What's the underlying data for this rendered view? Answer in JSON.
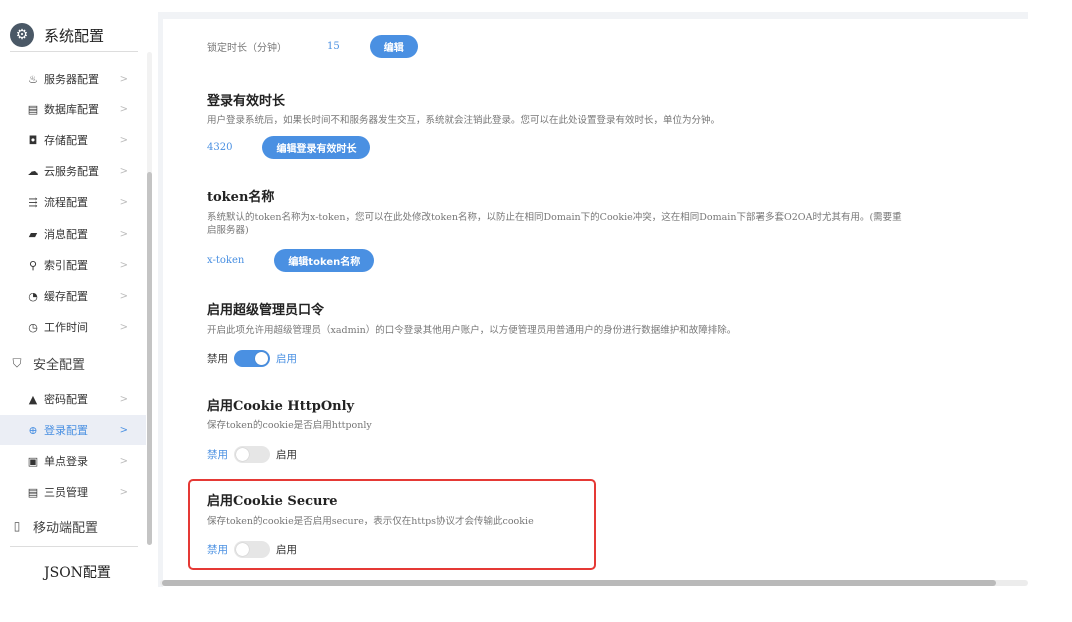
{
  "sidebar": {
    "title": "系统配置",
    "items": [
      {
        "icon": "server-icon",
        "glyph": "♨",
        "label": "服务器配置"
      },
      {
        "icon": "database-icon",
        "glyph": "▤",
        "label": "数据库配置"
      },
      {
        "icon": "storage-icon",
        "glyph": "◘",
        "label": "存储配置"
      },
      {
        "icon": "cloud-icon",
        "glyph": "☁",
        "label": "云服务配置"
      },
      {
        "icon": "flow-icon",
        "glyph": "⇶",
        "label": "流程配置"
      },
      {
        "icon": "message-icon",
        "glyph": "▰",
        "label": "消息配置"
      },
      {
        "icon": "search-icon",
        "glyph": "⚲",
        "label": "索引配置"
      },
      {
        "icon": "cache-icon",
        "glyph": "◔",
        "label": "缓存配置"
      },
      {
        "icon": "clock-icon",
        "glyph": "◷",
        "label": "工作时间"
      }
    ],
    "security_group": {
      "icon": "shield-icon",
      "glyph": "⛉",
      "label": "安全配置"
    },
    "security_items": [
      {
        "icon": "lock-icon",
        "glyph": "▲",
        "label": "密码配置"
      },
      {
        "icon": "login-icon",
        "glyph": "⊕",
        "label": "登录配置",
        "active": true
      },
      {
        "icon": "sso-icon",
        "glyph": "▣",
        "label": "单点登录"
      },
      {
        "icon": "admin-icon",
        "glyph": "▤",
        "label": "三员管理"
      }
    ],
    "mobile_group": {
      "icon": "mobile-icon",
      "glyph": "▯",
      "label": "移动端配置"
    },
    "json_config": "JSON配置",
    "chevron": ">"
  },
  "main": {
    "lock_duration": {
      "label": "锁定时长（分钟）",
      "value": "15",
      "button": "编辑"
    },
    "login_validity": {
      "title": "登录有效时长",
      "desc": "用户登录系统后，如果长时间不和服务器发生交互，系统就会注销此登录。您可以在此处设置登录有效时长，单位为分钟。",
      "value": "4320",
      "button": "编辑登录有效时长"
    },
    "token_name": {
      "title": "token名称",
      "desc": "系统默认的token名称为x-token，您可以在此处修改token名称，以防止在相同Domain下的Cookie冲突，这在相同Domain下部署多套O2OA时尤其有用。(需要重启服务器)",
      "value": "x-token",
      "button": "编辑token名称"
    },
    "super_admin": {
      "title": "启用超级管理员口令",
      "desc": "开启此项允许用超级管理员（xadmin）的口令登录其他用户账户，以方便管理员用普通用户的身份进行数据维护和故障排除。",
      "off_label": "禁用",
      "on_label": "启用",
      "enabled": true
    },
    "cookie_httponly": {
      "title": "启用Cookie HttpOnly",
      "desc": "保存token的cookie是否启用httponly",
      "off_label": "禁用",
      "on_label": "启用",
      "enabled": false
    },
    "cookie_secure": {
      "title": "启用Cookie Secure",
      "desc": "保存token的cookie是否启用secure，表示仅在https协议才会传输此cookie",
      "off_label": "禁用",
      "on_label": "启用",
      "enabled": false
    }
  },
  "colors": {
    "accent": "#4a90e2",
    "highlight_border": "#e53935"
  }
}
